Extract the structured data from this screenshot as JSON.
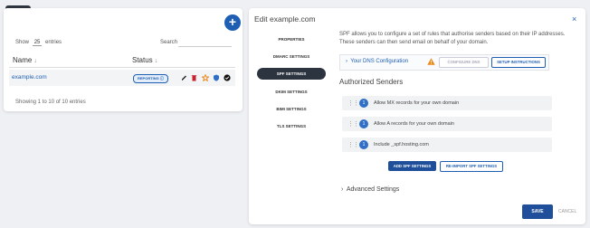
{
  "app": {
    "logo_icon": "list-icon"
  },
  "list": {
    "add_button": "+",
    "show_label": "Show",
    "entries_count": "25",
    "entries_label": "entries",
    "search_label": "Search",
    "columns": [
      "Name",
      "Status"
    ],
    "rows": [
      {
        "name": "example.com",
        "status": "REPORTING",
        "actions": [
          "edit-icon",
          "delete-icon",
          "star-icon",
          "shield-icon",
          "settings-icon"
        ]
      }
    ],
    "footer": "Showing 1 to 10 of 10 entries"
  },
  "panel": {
    "title": "Edit example.com",
    "close": "×",
    "tabs": [
      "PROPERTIES",
      "DMARC SETTINGS",
      "SPF SETTINGS",
      "DKIM SETTINGS",
      "BIMI SETTINGS",
      "TLS SETTINGS"
    ],
    "active_tab": "SPF SETTINGS",
    "description": "SPF allows you to configure a set of rules that authorise senders based on their IP addresses. These senders can then send email on behalf of your domain.",
    "dns_label": "Your DNS Configuration",
    "configure_label": "CONFIGURE DNS",
    "setup_label": "SETUP INSTRUCTIONS",
    "authorized_title": "Authorized Senders",
    "senders": [
      {
        "num": "1",
        "text": "Allow MX records for your own domain"
      },
      {
        "num": "1",
        "text": "Allow A records for your own domain"
      },
      {
        "num": "1",
        "text": "Include _spf.hosting.com"
      }
    ],
    "add_spf_label": "ADD SPF SETTINGS",
    "reimport_label": "RE-IMPORT SPF SETTINGS",
    "advanced_label": "Advanced Settings",
    "save_label": "SAVE",
    "cancel_label": "CANCEL"
  },
  "colors": {
    "accent": "#1f5fb3",
    "dark": "#2c3440",
    "warning": "#e8891a"
  }
}
